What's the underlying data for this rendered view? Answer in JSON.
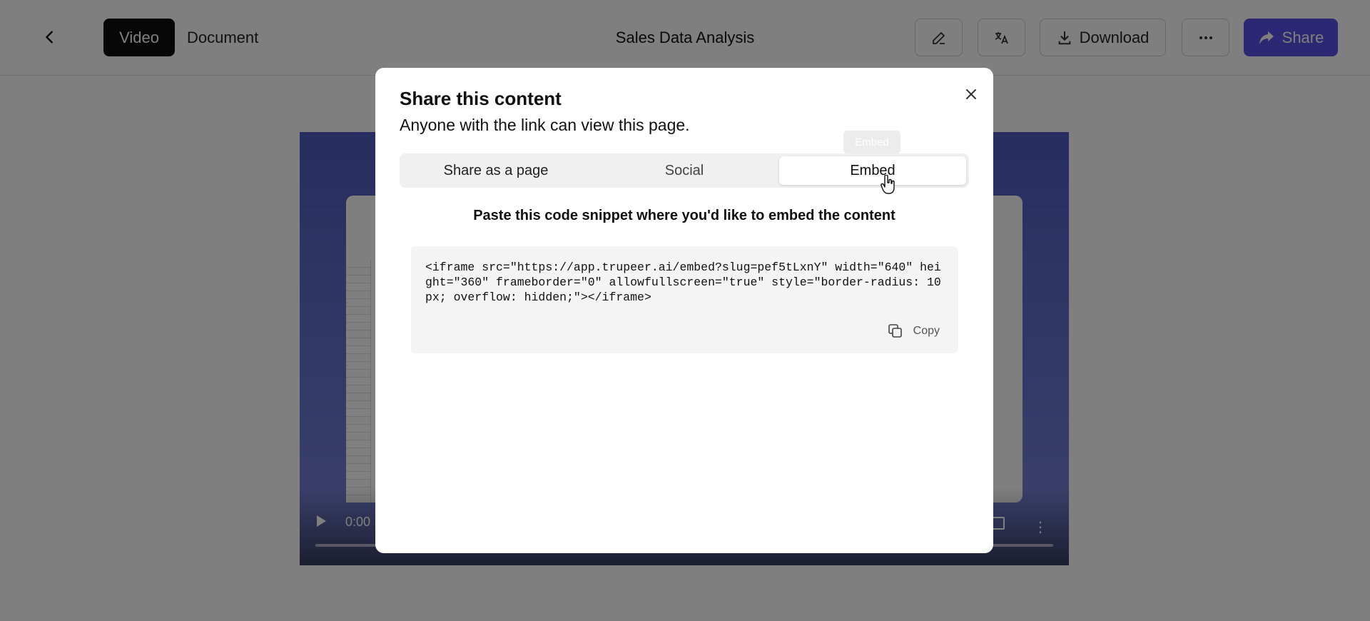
{
  "header": {
    "tabs": [
      {
        "label": "Video",
        "active": true
      },
      {
        "label": "Document",
        "active": false
      }
    ],
    "title": "Sales Data Analysis",
    "download_label": "Download",
    "share_label": "Share",
    "accent_color": "#5b50e6"
  },
  "video": {
    "time": "0:00"
  },
  "modal": {
    "title": "Share this content",
    "subtitle": "Anyone with the link can view this page.",
    "tabs": [
      {
        "label": "Share as a page"
      },
      {
        "label": "Social"
      },
      {
        "label": "Embed",
        "selected": true
      }
    ],
    "tooltip": "Embed",
    "instruction": "Paste this code snippet where you'd like to embed the content",
    "embed_code": "<iframe src=\"https://app.trupeer.ai/embed?slug=pef5tLxnY\" width=\"640\" height=\"360\" frameborder=\"0\" allowfullscreen=\"true\" style=\"border-radius: 10px; overflow: hidden;\"></iframe>",
    "copy_label": "Copy"
  }
}
